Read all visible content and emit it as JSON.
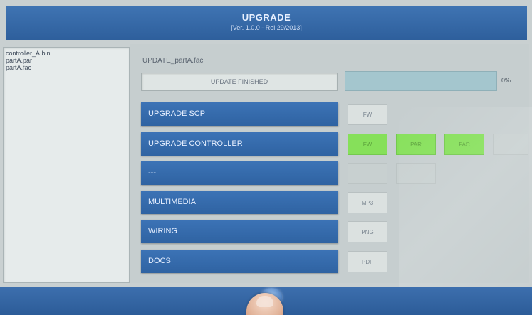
{
  "header": {
    "title": "UPGRADE",
    "subtitle": "[Ver. 1.0.0 - Rel.29/2013]"
  },
  "files": [
    "controller_A.bin",
    "partA.par",
    "partA.fac"
  ],
  "upload": {
    "filename": "UPDATE_partA.fac",
    "status": "UPDATE FINISHED",
    "progress_percent": 100,
    "progress_label": "0%"
  },
  "rows": [
    {
      "label": "UPGRADE SCP",
      "cells": [
        {
          "text": "FW",
          "state": "normal"
        }
      ]
    },
    {
      "label": "UPGRADE CONTROLLER",
      "cells": [
        {
          "text": "FW",
          "state": "green"
        },
        {
          "text": "PAR",
          "state": "green"
        },
        {
          "text": "FAC",
          "state": "green"
        },
        {
          "text": "",
          "state": "empty"
        }
      ]
    },
    {
      "label": "---",
      "cells": [
        {
          "text": "",
          "state": "empty"
        },
        {
          "text": "",
          "state": "empty"
        }
      ]
    },
    {
      "label": "MULTIMEDIA",
      "cells": [
        {
          "text": "MP3",
          "state": "normal"
        }
      ]
    },
    {
      "label": "WIRING",
      "cells": [
        {
          "text": "PNG",
          "state": "normal"
        }
      ]
    },
    {
      "label": "DOCS",
      "cells": [
        {
          "text": "PDF",
          "state": "normal"
        }
      ]
    }
  ],
  "colors": {
    "accent": "#3c73b6",
    "success": "#86e05a",
    "background": "#c9d0d1"
  },
  "icons": {
    "home": "home-button-icon"
  }
}
